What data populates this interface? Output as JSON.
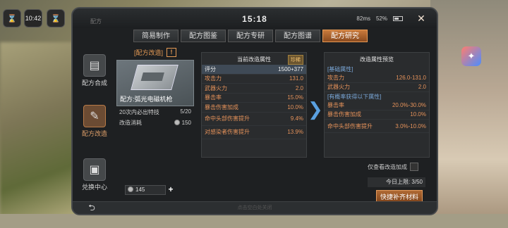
{
  "status": {
    "clock": "10:42",
    "time": "15:18",
    "ping": "82ms",
    "battery": "52%"
  },
  "window": {
    "title_small": "配方"
  },
  "tabs": [
    {
      "label": "简易制作"
    },
    {
      "label": "配方图鉴"
    },
    {
      "label": "配方专研"
    },
    {
      "label": "配方图谱"
    },
    {
      "label": "配方研究",
      "active": true
    }
  ],
  "nav": [
    {
      "label": "配方合成",
      "icon": "book-icon"
    },
    {
      "label": "配方改造",
      "icon": "notebook-icon",
      "active": true
    },
    {
      "label": "兑换中心",
      "icon": "bag-icon"
    }
  ],
  "card": {
    "header": "[配方改造]",
    "warn": "!",
    "item_name": "配方:弧光电磁机枪",
    "guarantee_label": "20次内必出特技",
    "guarantee_value": "5/20",
    "cost_label": "改造消耗",
    "cost_value": "150"
  },
  "currency": {
    "value": "145",
    "plus": "+"
  },
  "current": {
    "title": "当前改造属性",
    "badge": "珍稀",
    "score_label": "评分",
    "score_value": "1500+377",
    "rows": [
      {
        "k": "攻击力",
        "v": "131.0"
      },
      {
        "k": "武器火力",
        "v": "2.0"
      },
      {
        "k": "暴击率",
        "v": "15.0%"
      },
      {
        "k": "暴击伤害加成",
        "v": "10.0%"
      },
      {
        "k": "命中头部伤害提升",
        "v": "9.4%"
      },
      {
        "k": "对感染者伤害提升",
        "v": "13.9%"
      }
    ]
  },
  "preview": {
    "title": "改造属性预览",
    "basic_header": "[基础属性]",
    "basic": [
      {
        "k": "攻击力",
        "v": "126.0-131.0"
      },
      {
        "k": "武器火力",
        "v": "2.0"
      }
    ],
    "chance_header": "[有概率获得以下属性]",
    "chance": [
      {
        "k": "暴击率",
        "v": "20.0%-30.0%"
      },
      {
        "k": "暴击伤害加成",
        "v": "10.0%"
      },
      {
        "k": "命中头部伤害提升",
        "v": "3.0%-10.0%"
      }
    ]
  },
  "footer": {
    "only_view": "仅查看改造加成",
    "limit": "今日上限: 3/50",
    "refill": "快捷补齐材料",
    "back": "⮌",
    "hint": "点击空白处关闭"
  },
  "colors": {
    "accent": "#e5925a",
    "tab_active": "#c97a3c",
    "section_blue": "#7aa7d8"
  }
}
